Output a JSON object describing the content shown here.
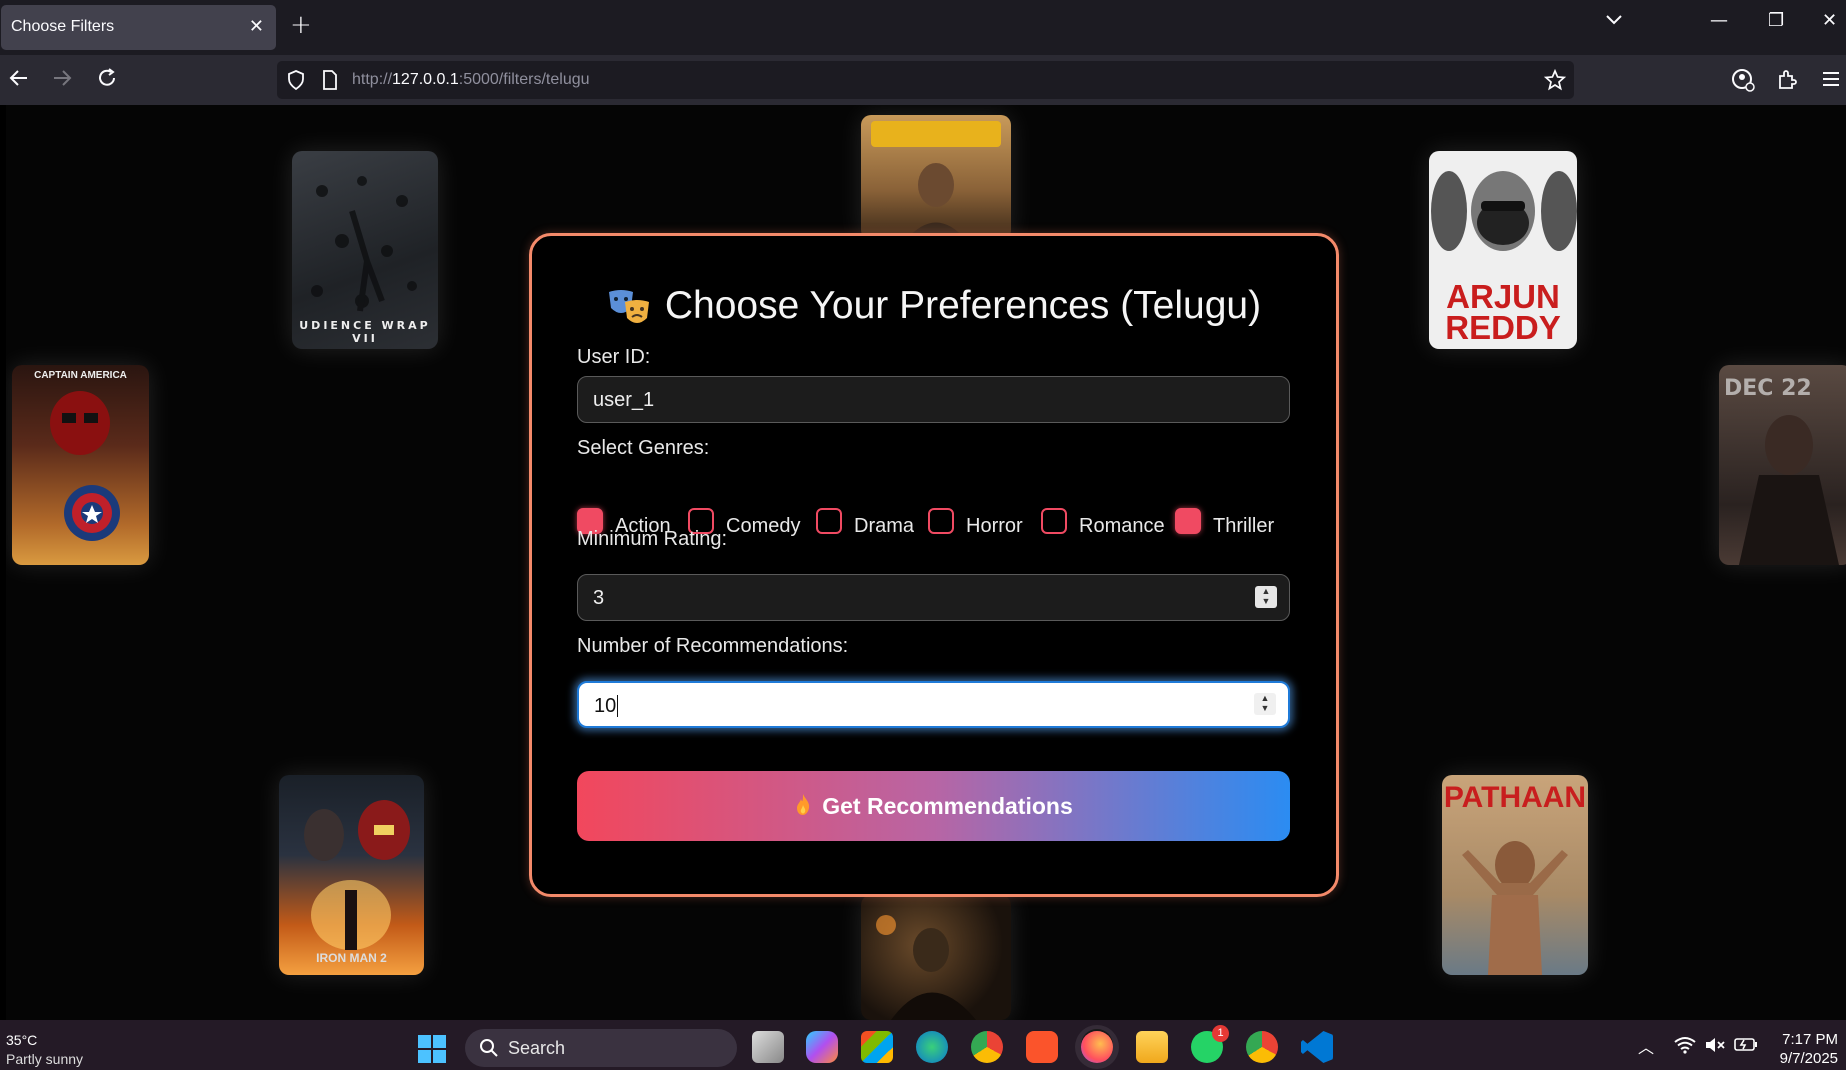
{
  "browser": {
    "tab_title": "Choose Filters",
    "url_prefix": "http://",
    "url_host": "127.0.0.1",
    "url_path": ":5000/filters/telugu"
  },
  "form": {
    "title": "Choose Your Preferences (Telugu)",
    "user_id_label": "User ID:",
    "user_id_value": "user_1",
    "genres_label": "Select Genres:",
    "genres": [
      {
        "label": "Action",
        "checked": true
      },
      {
        "label": "Comedy",
        "checked": false
      },
      {
        "label": "Drama",
        "checked": false
      },
      {
        "label": "Horror",
        "checked": false
      },
      {
        "label": "Romance",
        "checked": false
      },
      {
        "label": "Thriller",
        "checked": true
      }
    ],
    "min_rating_label": "Minimum Rating:",
    "min_rating_value": "3",
    "num_recs_label": "Number of Recommendations:",
    "num_recs_value": "10",
    "submit_label": "Get Recommendations"
  },
  "posters": {
    "arjun_reddy_line1": "ARJUN",
    "arjun_reddy_line2": "REDDY",
    "pathaan": "PATHAAN",
    "captain_america": "CAPTAIN AMERICA",
    "audience_wrap": "UDIENCE WRAP VII",
    "iron_man": "IRON MAN 2"
  },
  "taskbar": {
    "temperature": "35°C",
    "weather": "Partly sunny",
    "search_label": "Search",
    "time": "7:17 PM",
    "date": "9/7/2025",
    "whatsapp_badge": "1"
  },
  "colors": {
    "accent_red": "#f04a62",
    "accent_blue": "#2b8cf2",
    "panel_border": "#f48a6a"
  }
}
